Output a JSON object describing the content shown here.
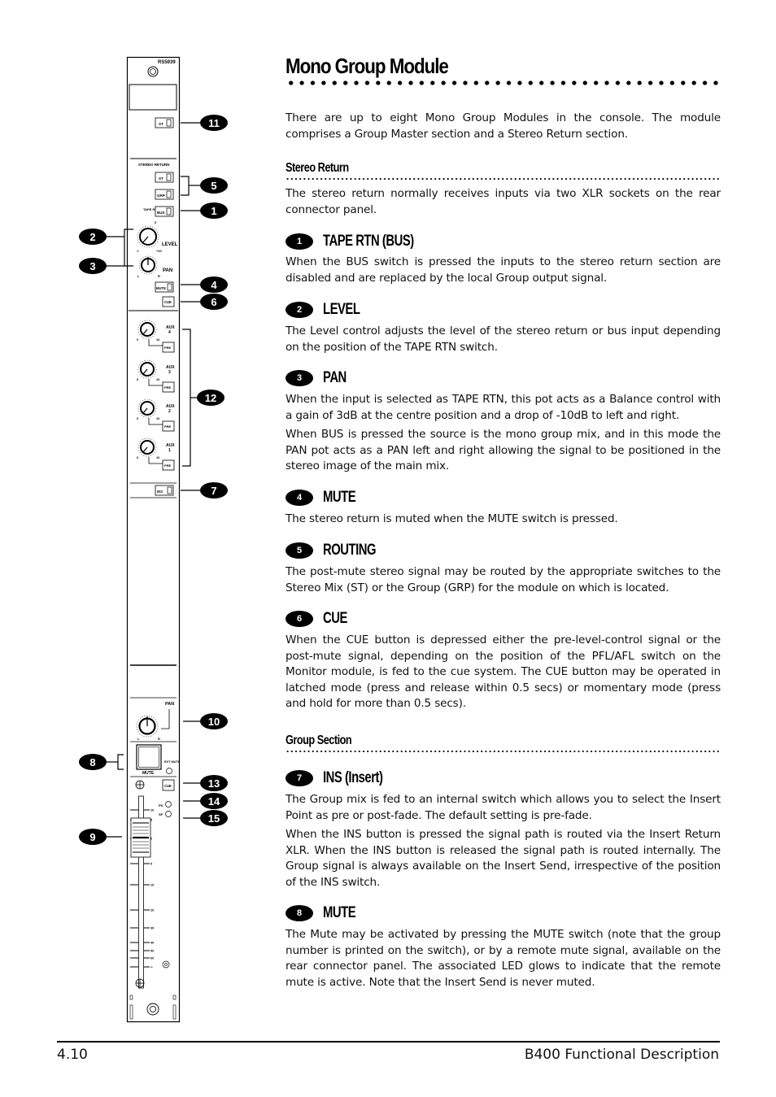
{
  "page": {
    "title": "Mono Group Module",
    "intro": "There are up to eight Mono Group Modules in the console.  The module comprises a Group Master section and a Stereo Return section.",
    "footer": {
      "page_number": "4.10",
      "document_title": "B400 Functional Description"
    }
  },
  "sections": {
    "stereo_return": {
      "heading": "Stereo Return",
      "body": "The stereo return normally receives inputs via two XLR sockets on the rear connector panel."
    },
    "group_section": {
      "heading": "Group Section"
    }
  },
  "items": [
    {
      "number": "1",
      "title": "TAPE RTN (BUS)",
      "paragraphs": [
        "When the BUS switch is pressed the inputs to the stereo return section are disabled and are replaced by the local Group output signal."
      ]
    },
    {
      "number": "2",
      "title": "LEVEL",
      "paragraphs": [
        "The Level control adjusts the level of the stereo return or bus input depending on the position of the TAPE RTN switch."
      ]
    },
    {
      "number": "3",
      "title": "PAN",
      "paragraphs": [
        "When the input is selected as TAPE RTN, this pot acts as a Balance control with a gain of 3dB at the centre position and a drop of -10dB to left and right.",
        "When BUS is pressed the source is the mono group mix, and in this mode the PAN pot acts as a PAN left and right allowing the signal to be positioned in the stereo image of the main mix."
      ]
    },
    {
      "number": "4",
      "title": "MUTE",
      "paragraphs": [
        "The stereo return is muted when the MUTE switch is pressed."
      ]
    },
    {
      "number": "5",
      "title": "ROUTING",
      "paragraphs": [
        "The post-mute stereo signal may be routed by the appropriate switches to the Stereo Mix (ST) or the Group (GRP) for the module on which is located."
      ]
    },
    {
      "number": "6",
      "title": "CUE",
      "paragraphs": [
        "When the CUE button is depressed either the pre-level-control signal or the post-mute signal, depending on the position of the PFL/AFL switch on the Monitor module, is fed to the cue system. The CUE button may be operated in latched mode (press and release within 0.5 secs) or momentary mode (press and hold for more than 0.5 secs)."
      ]
    },
    {
      "number": "7",
      "title": "INS (Insert)",
      "paragraphs": [
        "The Group mix is fed to an internal switch which allows you to select the Insert Point as pre or post-fade.  The default setting is pre-fade.",
        "When the INS button is pressed the signal path is routed via the Insert Return XLR. When the INS button is released the signal path is routed internally.  The Group signal is always available on the Insert Send, irrespective of the position of the INS switch."
      ]
    },
    {
      "number": "8",
      "title": "MUTE",
      "paragraphs": [
        "The Mute may be activated by pressing the MUTE switch (note that the group number is printed on the  switch), or by a remote mute signal, available on the rear connector panel. The associated LED glows to indicate that the remote mute is active.  Note that the Insert Send is never muted."
      ]
    }
  ],
  "module_diagram": {
    "model": "RS5939",
    "stereo_return_label": "STEREO RETURN",
    "switches": {
      "st_top": "ST",
      "st": "ST",
      "grp": "GRP",
      "tape_rtn": "TAPE RTN",
      "bus": "BUS",
      "mute": "MUTE",
      "cue": "CUE",
      "ins": "INS",
      "pre": "PRE",
      "group_cue": "CUE"
    },
    "knobs": {
      "level": {
        "label": "LEVEL",
        "min": "∞",
        "center": "0",
        "max": "+10"
      },
      "pan": {
        "label": "PAN",
        "left": "L",
        "right": "R"
      },
      "aux": [
        {
          "label": "AUX",
          "number": "4",
          "min": "0",
          "max": "10"
        },
        {
          "label": "AUX",
          "number": "3",
          "min": "0",
          "max": "10"
        },
        {
          "label": "AUX",
          "number": "2",
          "min": "0",
          "max": "10"
        },
        {
          "label": "AUX",
          "number": "1",
          "min": "0",
          "max": "10"
        }
      ],
      "group_pan": {
        "label": "PAN",
        "left": "L",
        "right": "R"
      }
    },
    "group_mute": {
      "label": "MUTE",
      "ext_mute": "EXT MUTE"
    },
    "leds": {
      "pk": "PK",
      "sp": "SP"
    },
    "fader_scale": [
      "10",
      "5",
      "0",
      "5",
      "10",
      "20",
      "30",
      "40",
      "50",
      "60",
      "∞"
    ],
    "callouts": [
      "11",
      "5",
      "1",
      "2",
      "3",
      "4",
      "6",
      "12",
      "7",
      "10",
      "8",
      "13",
      "14",
      "15",
      "9"
    ]
  }
}
